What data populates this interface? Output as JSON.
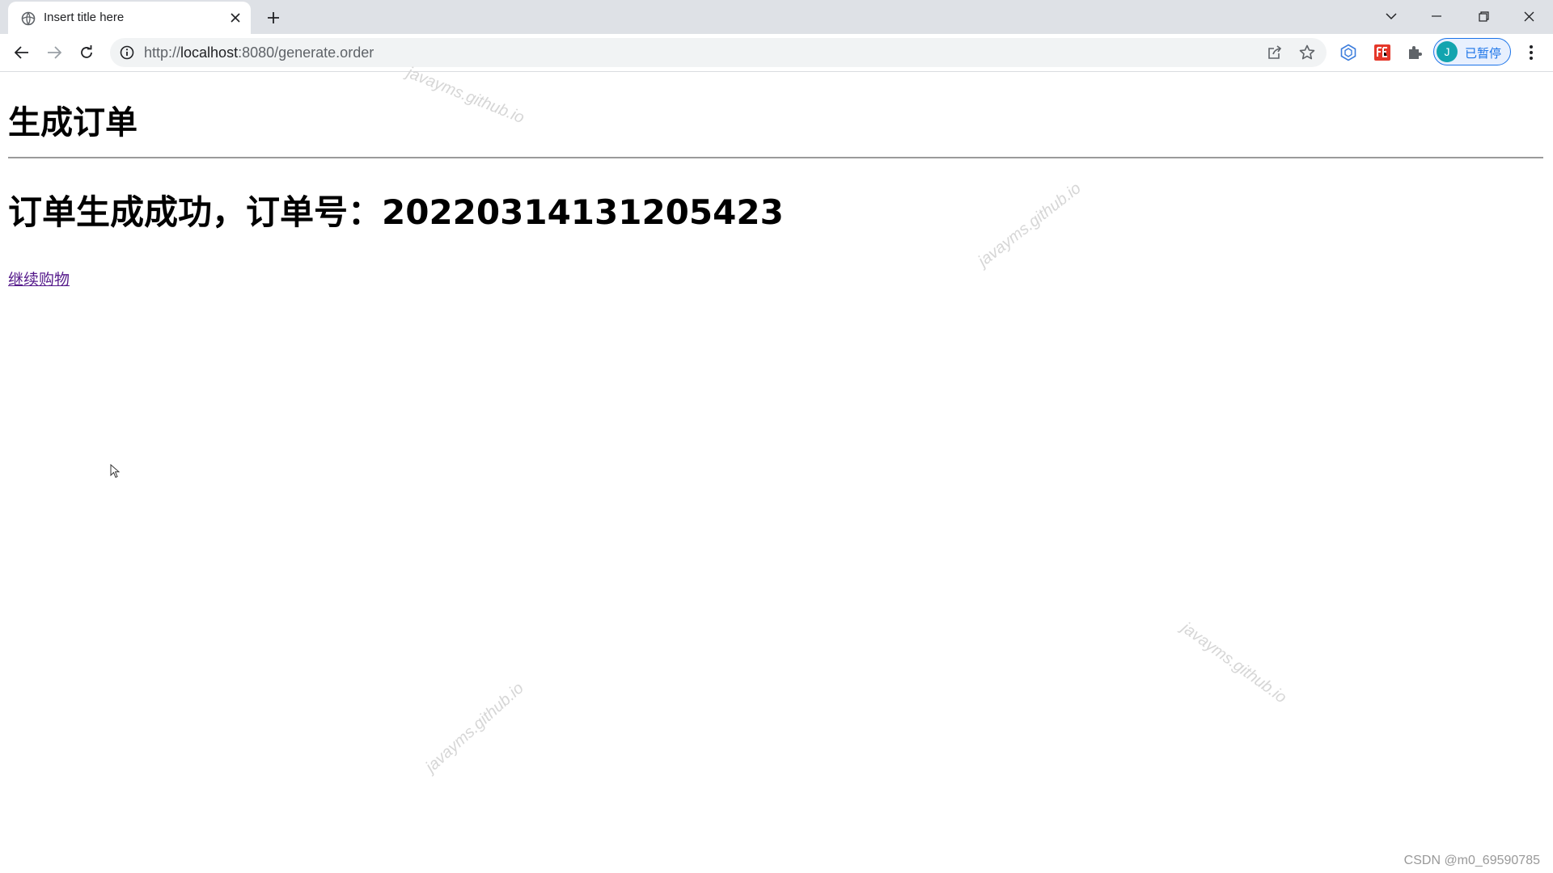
{
  "browser": {
    "tab": {
      "title": "Insert title here"
    },
    "address_bar": {
      "url_prefix": "http://",
      "url_host": "localhost",
      "url_rest": ":8080/generate.order"
    },
    "profile": {
      "avatar_letter": "J",
      "label": "已暂停"
    }
  },
  "page": {
    "heading": "生成订单",
    "message": "订单生成成功，订单号：20220314131205423",
    "link_label": "继续购物"
  },
  "watermark_text": "javayms.github.io",
  "footer_watermark": "CSDN @m0_69590785"
}
